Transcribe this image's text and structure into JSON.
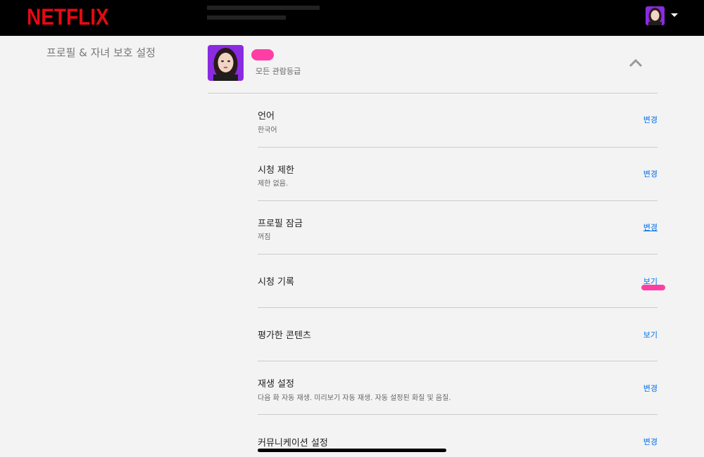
{
  "header": {
    "brand": "NETFLIX"
  },
  "sidebar": {
    "title": "프로필 & 자녀 보호 설정"
  },
  "profile": {
    "maturity": "모든 관람등급"
  },
  "settings": [
    {
      "label": "언어",
      "value": "한국어",
      "action": "변경"
    },
    {
      "label": "시청 제한",
      "value": "제한 없음.",
      "action": "변경"
    },
    {
      "label": "프로필 잠금",
      "value": "꺼짐",
      "action": "변경"
    },
    {
      "label": "시청 기록",
      "value": "",
      "action": "보기"
    },
    {
      "label": "평가한 콘텐츠",
      "value": "",
      "action": "보기"
    },
    {
      "label": "재생 설정",
      "value": "다음 화 자동 재생. 미리보기 자동 재생. 자동 설정된 화질 및 음질.",
      "action": "변경"
    },
    {
      "label": "커뮤니케이션 설정",
      "value": "",
      "action": "변경"
    }
  ],
  "colors": {
    "brand": "#e50914",
    "link": "#0071eb",
    "background": "#f3f3f3",
    "header": "#000000",
    "redaction": "#ff3ea5"
  },
  "icons": {
    "collapse": "chevron-up-icon",
    "account_menu": "caret-down-icon"
  }
}
